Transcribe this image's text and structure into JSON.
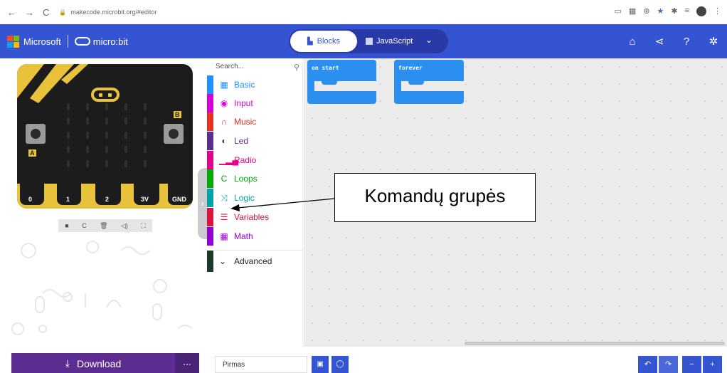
{
  "browser": {
    "back": "←",
    "forward": "→",
    "reload": "C",
    "lock": "🔒",
    "url": "makecode.microbit.org/#editor"
  },
  "header": {
    "brand": "Microsoft",
    "product": "micro:bit",
    "tab_blocks": "Blocks",
    "tab_javascript": "JavaScript",
    "home_icon": "home-icon",
    "share_icon": "share-icon",
    "help_icon": "help-icon",
    "settings_icon": "gear-icon"
  },
  "simulator": {
    "pins": [
      "0",
      "1",
      "2",
      "3V",
      "GND"
    ],
    "button_a": "A",
    "button_b": "B",
    "controls": [
      "■",
      "C",
      "🗑",
      "◁)",
      "⛶"
    ]
  },
  "toolbox": {
    "search_placeholder": "Search...",
    "categories": [
      {
        "label": "Basic",
        "color": "#1e90ff",
        "icon": "grid-icon"
      },
      {
        "label": "Input",
        "color": "#d400d4",
        "icon": "target-icon"
      },
      {
        "label": "Music",
        "color": "#e63022",
        "icon": "headphones-icon"
      },
      {
        "label": "Led",
        "color": "#5c2d91",
        "icon": "toggle-icon"
      },
      {
        "label": "Radio",
        "color": "#e3008c",
        "icon": "signal-icon"
      },
      {
        "label": "Loops",
        "color": "#00aa00",
        "icon": "loop-icon"
      },
      {
        "label": "Logic",
        "color": "#00a4a6",
        "icon": "shuffle-icon"
      },
      {
        "label": "Variables",
        "color": "#dc143c",
        "icon": "lines-icon"
      },
      {
        "label": "Math",
        "color": "#9400d3",
        "icon": "calculator-icon"
      }
    ],
    "advanced": "Advanced"
  },
  "workspace": {
    "blocks": [
      {
        "label": "on start"
      },
      {
        "label": "forever"
      }
    ]
  },
  "callout": {
    "text": "Komandų grupės"
  },
  "bottom": {
    "download": "Download",
    "more": "...",
    "project_name": "Pirmas"
  }
}
